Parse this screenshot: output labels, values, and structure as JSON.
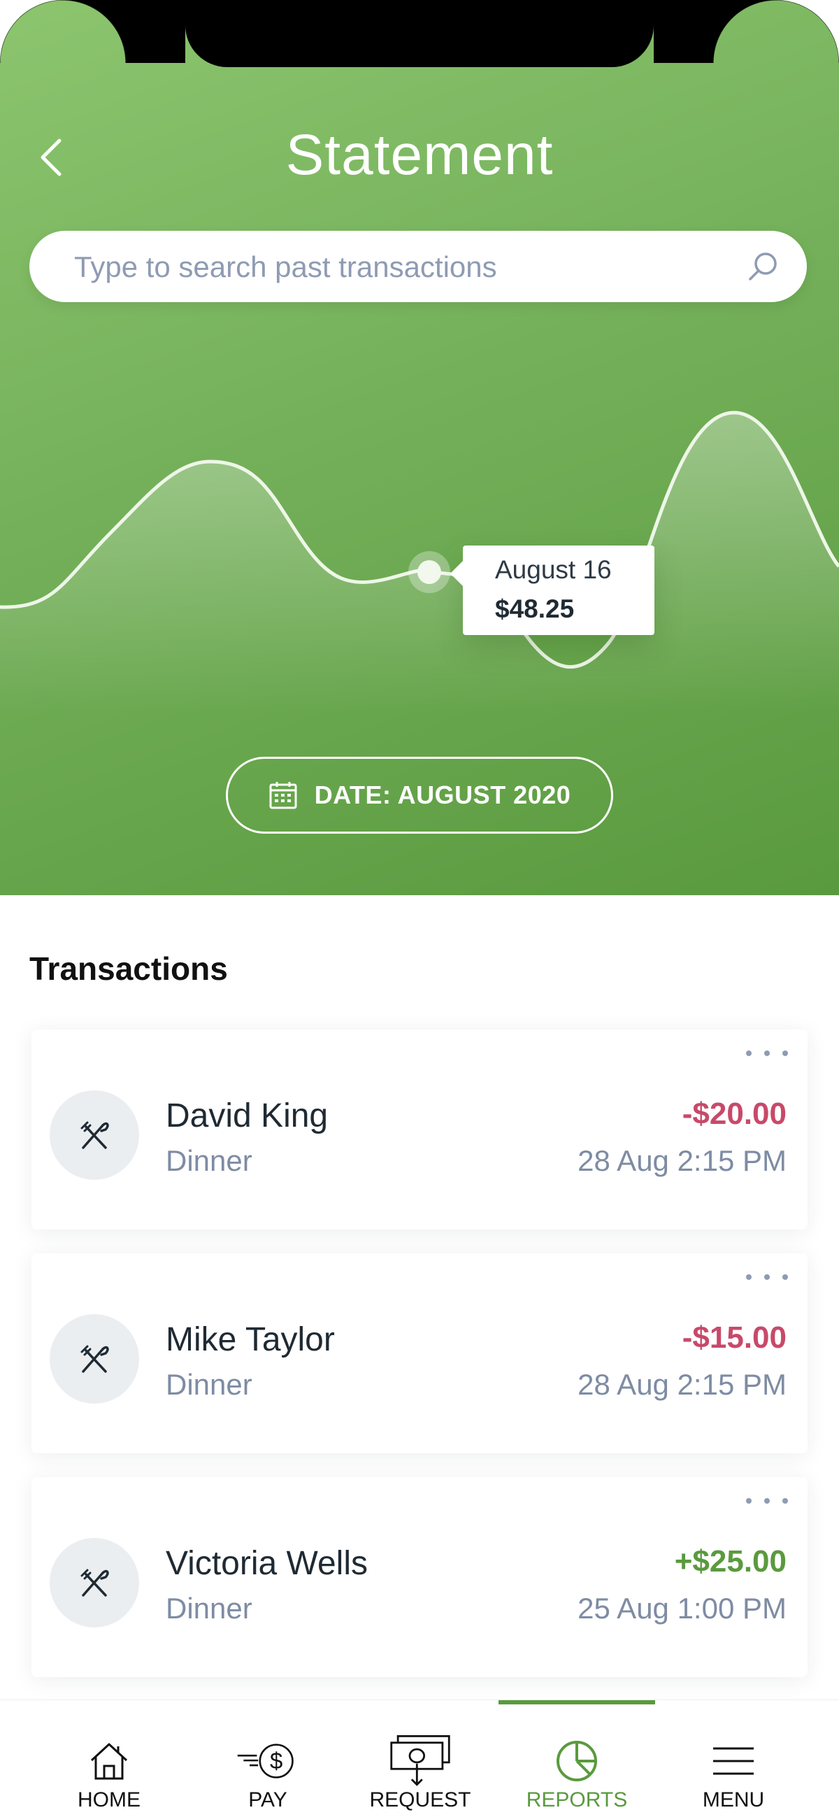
{
  "header": {
    "title": "Statement",
    "back_icon": "chevron-left-icon"
  },
  "search": {
    "placeholder": "Type to search past transactions",
    "value": "",
    "icon": "search-icon"
  },
  "chart_data": {
    "type": "area",
    "title": "",
    "xlabel": "",
    "ylabel": "",
    "grid": false,
    "legend": "none",
    "highlight": {
      "label": "August 16",
      "value": "$48.25"
    },
    "colors": {
      "line": "#eef6e8",
      "fill": "#ffffff"
    }
  },
  "date_filter": {
    "label": "DATE: AUGUST 2020",
    "icon": "calendar-icon"
  },
  "transactions": {
    "title": "Transactions",
    "items": [
      {
        "name": "David King",
        "category": "Dinner",
        "amount": "-$20.00",
        "time": "28 Aug 2:15 PM",
        "type": "debit",
        "icon": "fork-knife-icon"
      },
      {
        "name": "Mike Taylor",
        "category": "Dinner",
        "amount": "-$15.00",
        "time": "28 Aug 2:15 PM",
        "type": "debit",
        "icon": "fork-knife-icon"
      },
      {
        "name": "Victoria Wells",
        "category": "Dinner",
        "amount": "+$25.00",
        "time": "25 Aug 1:00 PM",
        "type": "credit",
        "icon": "fork-knife-icon"
      }
    ]
  },
  "tabbar": {
    "items": [
      {
        "label": "HOME",
        "icon": "home-icon",
        "active": false
      },
      {
        "label": "PAY",
        "icon": "pay-dollar-icon",
        "active": false
      },
      {
        "label": "REQUEST",
        "icon": "request-money-icon",
        "active": false
      },
      {
        "label": "REPORTS",
        "icon": "pie-chart-icon",
        "active": true
      },
      {
        "label": "MENU",
        "icon": "hamburger-menu-icon",
        "active": false
      }
    ]
  },
  "colors": {
    "accent": "#5a9a3e",
    "negative": "#c8496a",
    "positive": "#5a9a3e",
    "muted": "#7e8ca3"
  }
}
